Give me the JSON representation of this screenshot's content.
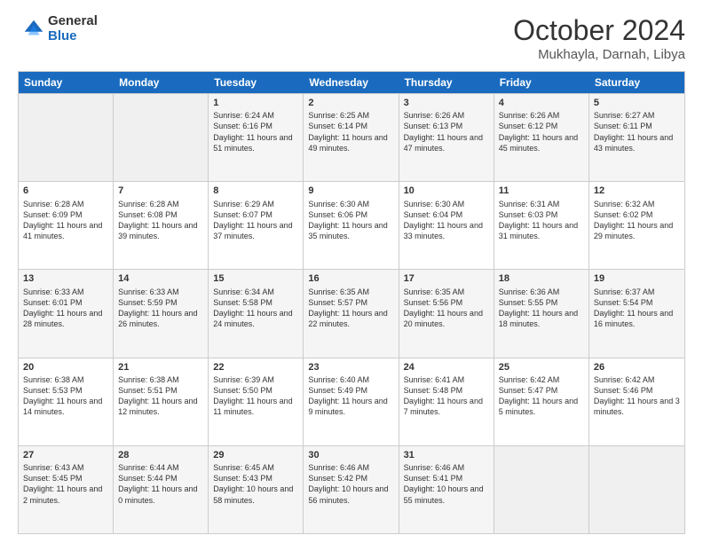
{
  "logo": {
    "general": "General",
    "blue": "Blue"
  },
  "header": {
    "month": "October 2024",
    "location": "Mukhayla, Darnah, Libya"
  },
  "days_of_week": [
    "Sunday",
    "Monday",
    "Tuesday",
    "Wednesday",
    "Thursday",
    "Friday",
    "Saturday"
  ],
  "weeks": [
    [
      {
        "day": "",
        "sunrise": "",
        "sunset": "",
        "daylight": "",
        "empty": true
      },
      {
        "day": "",
        "sunrise": "",
        "sunset": "",
        "daylight": "",
        "empty": true
      },
      {
        "day": "1",
        "sunrise": "Sunrise: 6:24 AM",
        "sunset": "Sunset: 6:16 PM",
        "daylight": "Daylight: 11 hours and 51 minutes.",
        "empty": false
      },
      {
        "day": "2",
        "sunrise": "Sunrise: 6:25 AM",
        "sunset": "Sunset: 6:14 PM",
        "daylight": "Daylight: 11 hours and 49 minutes.",
        "empty": false
      },
      {
        "day": "3",
        "sunrise": "Sunrise: 6:26 AM",
        "sunset": "Sunset: 6:13 PM",
        "daylight": "Daylight: 11 hours and 47 minutes.",
        "empty": false
      },
      {
        "day": "4",
        "sunrise": "Sunrise: 6:26 AM",
        "sunset": "Sunset: 6:12 PM",
        "daylight": "Daylight: 11 hours and 45 minutes.",
        "empty": false
      },
      {
        "day": "5",
        "sunrise": "Sunrise: 6:27 AM",
        "sunset": "Sunset: 6:11 PM",
        "daylight": "Daylight: 11 hours and 43 minutes.",
        "empty": false
      }
    ],
    [
      {
        "day": "6",
        "sunrise": "Sunrise: 6:28 AM",
        "sunset": "Sunset: 6:09 PM",
        "daylight": "Daylight: 11 hours and 41 minutes.",
        "empty": false
      },
      {
        "day": "7",
        "sunrise": "Sunrise: 6:28 AM",
        "sunset": "Sunset: 6:08 PM",
        "daylight": "Daylight: 11 hours and 39 minutes.",
        "empty": false
      },
      {
        "day": "8",
        "sunrise": "Sunrise: 6:29 AM",
        "sunset": "Sunset: 6:07 PM",
        "daylight": "Daylight: 11 hours and 37 minutes.",
        "empty": false
      },
      {
        "day": "9",
        "sunrise": "Sunrise: 6:30 AM",
        "sunset": "Sunset: 6:06 PM",
        "daylight": "Daylight: 11 hours and 35 minutes.",
        "empty": false
      },
      {
        "day": "10",
        "sunrise": "Sunrise: 6:30 AM",
        "sunset": "Sunset: 6:04 PM",
        "daylight": "Daylight: 11 hours and 33 minutes.",
        "empty": false
      },
      {
        "day": "11",
        "sunrise": "Sunrise: 6:31 AM",
        "sunset": "Sunset: 6:03 PM",
        "daylight": "Daylight: 11 hours and 31 minutes.",
        "empty": false
      },
      {
        "day": "12",
        "sunrise": "Sunrise: 6:32 AM",
        "sunset": "Sunset: 6:02 PM",
        "daylight": "Daylight: 11 hours and 29 minutes.",
        "empty": false
      }
    ],
    [
      {
        "day": "13",
        "sunrise": "Sunrise: 6:33 AM",
        "sunset": "Sunset: 6:01 PM",
        "daylight": "Daylight: 11 hours and 28 minutes.",
        "empty": false
      },
      {
        "day": "14",
        "sunrise": "Sunrise: 6:33 AM",
        "sunset": "Sunset: 5:59 PM",
        "daylight": "Daylight: 11 hours and 26 minutes.",
        "empty": false
      },
      {
        "day": "15",
        "sunrise": "Sunrise: 6:34 AM",
        "sunset": "Sunset: 5:58 PM",
        "daylight": "Daylight: 11 hours and 24 minutes.",
        "empty": false
      },
      {
        "day": "16",
        "sunrise": "Sunrise: 6:35 AM",
        "sunset": "Sunset: 5:57 PM",
        "daylight": "Daylight: 11 hours and 22 minutes.",
        "empty": false
      },
      {
        "day": "17",
        "sunrise": "Sunrise: 6:35 AM",
        "sunset": "Sunset: 5:56 PM",
        "daylight": "Daylight: 11 hours and 20 minutes.",
        "empty": false
      },
      {
        "day": "18",
        "sunrise": "Sunrise: 6:36 AM",
        "sunset": "Sunset: 5:55 PM",
        "daylight": "Daylight: 11 hours and 18 minutes.",
        "empty": false
      },
      {
        "day": "19",
        "sunrise": "Sunrise: 6:37 AM",
        "sunset": "Sunset: 5:54 PM",
        "daylight": "Daylight: 11 hours and 16 minutes.",
        "empty": false
      }
    ],
    [
      {
        "day": "20",
        "sunrise": "Sunrise: 6:38 AM",
        "sunset": "Sunset: 5:53 PM",
        "daylight": "Daylight: 11 hours and 14 minutes.",
        "empty": false
      },
      {
        "day": "21",
        "sunrise": "Sunrise: 6:38 AM",
        "sunset": "Sunset: 5:51 PM",
        "daylight": "Daylight: 11 hours and 12 minutes.",
        "empty": false
      },
      {
        "day": "22",
        "sunrise": "Sunrise: 6:39 AM",
        "sunset": "Sunset: 5:50 PM",
        "daylight": "Daylight: 11 hours and 11 minutes.",
        "empty": false
      },
      {
        "day": "23",
        "sunrise": "Sunrise: 6:40 AM",
        "sunset": "Sunset: 5:49 PM",
        "daylight": "Daylight: 11 hours and 9 minutes.",
        "empty": false
      },
      {
        "day": "24",
        "sunrise": "Sunrise: 6:41 AM",
        "sunset": "Sunset: 5:48 PM",
        "daylight": "Daylight: 11 hours and 7 minutes.",
        "empty": false
      },
      {
        "day": "25",
        "sunrise": "Sunrise: 6:42 AM",
        "sunset": "Sunset: 5:47 PM",
        "daylight": "Daylight: 11 hours and 5 minutes.",
        "empty": false
      },
      {
        "day": "26",
        "sunrise": "Sunrise: 6:42 AM",
        "sunset": "Sunset: 5:46 PM",
        "daylight": "Daylight: 11 hours and 3 minutes.",
        "empty": false
      }
    ],
    [
      {
        "day": "27",
        "sunrise": "Sunrise: 6:43 AM",
        "sunset": "Sunset: 5:45 PM",
        "daylight": "Daylight: 11 hours and 2 minutes.",
        "empty": false
      },
      {
        "day": "28",
        "sunrise": "Sunrise: 6:44 AM",
        "sunset": "Sunset: 5:44 PM",
        "daylight": "Daylight: 11 hours and 0 minutes.",
        "empty": false
      },
      {
        "day": "29",
        "sunrise": "Sunrise: 6:45 AM",
        "sunset": "Sunset: 5:43 PM",
        "daylight": "Daylight: 10 hours and 58 minutes.",
        "empty": false
      },
      {
        "day": "30",
        "sunrise": "Sunrise: 6:46 AM",
        "sunset": "Sunset: 5:42 PM",
        "daylight": "Daylight: 10 hours and 56 minutes.",
        "empty": false
      },
      {
        "day": "31",
        "sunrise": "Sunrise: 6:46 AM",
        "sunset": "Sunset: 5:41 PM",
        "daylight": "Daylight: 10 hours and 55 minutes.",
        "empty": false
      },
      {
        "day": "",
        "sunrise": "",
        "sunset": "",
        "daylight": "",
        "empty": true
      },
      {
        "day": "",
        "sunrise": "",
        "sunset": "",
        "daylight": "",
        "empty": true
      }
    ]
  ]
}
